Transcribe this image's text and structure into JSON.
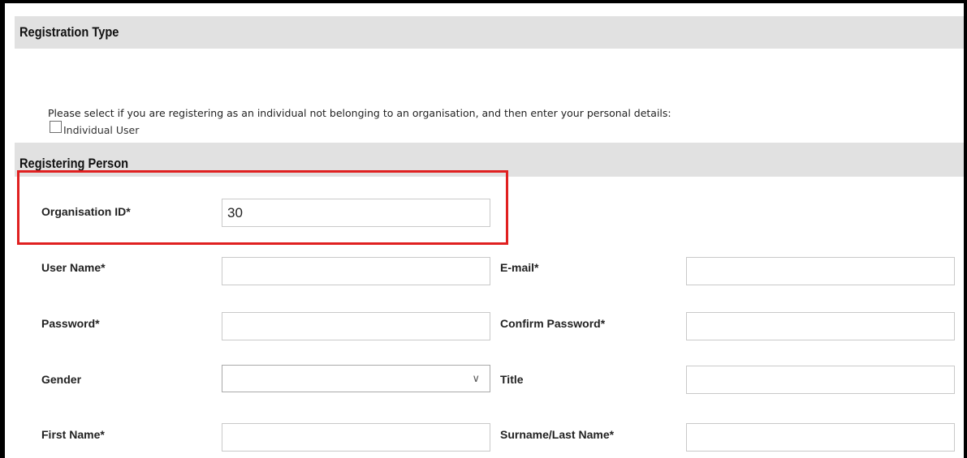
{
  "registration_type": {
    "title": "Registration Type",
    "intro": "Please select if you are registering as an individual not belonging to an organisation, and then enter your personal details:",
    "individual_user_label": "Individual User",
    "individual_user_checked": false
  },
  "registering_person": {
    "title": "Registering Person",
    "fields": {
      "organisation_id": {
        "label": "Organisation ID*",
        "value": "30"
      },
      "user_name": {
        "label": "User Name*",
        "value": ""
      },
      "email": {
        "label": "E-mail*",
        "value": ""
      },
      "password": {
        "label": "Password*",
        "value": ""
      },
      "confirm_password": {
        "label": "Confirm Password*",
        "value": ""
      },
      "gender": {
        "label": "Gender",
        "value": ""
      },
      "title": {
        "label": "Title",
        "value": ""
      },
      "first_name": {
        "label": "First Name*",
        "value": ""
      },
      "last_name": {
        "label": "Surname/Last Name*",
        "value": ""
      }
    }
  },
  "colors": {
    "section_header_bg": "#e1e1e1",
    "highlight_border": "#e02020"
  }
}
